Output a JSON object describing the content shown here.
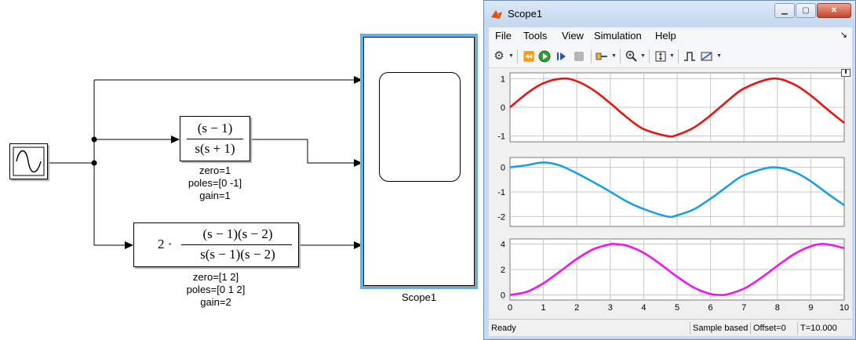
{
  "diagram": {
    "tf1": {
      "numerator": "(s − 1)",
      "denominator": "s(s + 1)",
      "zero": "zero=1",
      "poles": "poles=[0 -1]",
      "gain": "gain=1"
    },
    "tf2": {
      "prefix": "2 ·",
      "numerator": "(s − 1)(s − 2)",
      "denominator": "s(s − 1)(s − 2)",
      "zero": "zero=[1 2]",
      "poles": "poles=[0 1 2]",
      "gain": "gain=2"
    },
    "scope_label": "Scope1"
  },
  "window": {
    "title": "Scope1",
    "menu": [
      "File",
      "Tools",
      "View",
      "Simulation",
      "Help"
    ],
    "toolbar_icons": [
      "gear-icon",
      "step-back-icon",
      "run-icon",
      "step-forward-icon",
      "stop-icon",
      "highlight-icon",
      "zoom-icon",
      "autoscale-icon",
      "triggers-icon",
      "measurements-icon"
    ],
    "status": {
      "state": "Ready",
      "mode": "Sample based",
      "offset": "Offset=0",
      "time": "T=10.000"
    }
  },
  "chart_data": [
    {
      "type": "line",
      "x": [
        0,
        0.5,
        1,
        1.5708,
        2,
        2.5,
        3,
        3.5,
        4,
        4.7124,
        5,
        5.5,
        6,
        6.5,
        7,
        7.854,
        8.5,
        9,
        9.5,
        10
      ],
      "series": [
        {
          "values": [
            0,
            0.479,
            0.841,
            1,
            0.909,
            0.598,
            0.141,
            -0.351,
            -0.757,
            -1,
            -0.959,
            -0.706,
            -0.279,
            0.215,
            0.657,
            1,
            0.798,
            0.412,
            -0.075,
            -0.544
          ]
        }
      ],
      "ylim": [
        -1.2,
        1.2
      ],
      "yticks": [
        "1",
        "0",
        "-1"
      ],
      "color": "#e8140f",
      "grid": true
    },
    {
      "type": "line",
      "x": [
        0,
        0.5,
        1,
        1.5,
        2,
        2.5,
        3,
        3.5,
        4,
        4.7124,
        5,
        5.5,
        6,
        6.5,
        7,
        7.854,
        8.5,
        9,
        9.5,
        10
      ],
      "series": [
        {
          "values": [
            0,
            0.086,
            0.197,
            0.071,
            -0.244,
            -0.605,
            -0.991,
            -1.392,
            -1.695,
            -2,
            -1.95,
            -1.707,
            -1.276,
            -0.777,
            -0.323,
            0,
            -0.188,
            -0.566,
            -1.068,
            -1.54
          ]
        }
      ],
      "ylim": [
        -2.4,
        0.4
      ],
      "yticks": [
        "0",
        "-1",
        "-2"
      ],
      "color": "#1f9ee8",
      "grid": true
    },
    {
      "type": "line",
      "x": [
        0,
        0.5,
        1,
        1.5,
        2,
        2.5,
        3,
        3.1416,
        3.5,
        4,
        4.5,
        5,
        5.5,
        6,
        6.2832,
        6.5,
        7,
        7.5,
        8,
        8.5,
        9,
        9.4248,
        10
      ],
      "series": [
        {
          "values": [
            0,
            0.245,
            0.919,
            1.859,
            2.832,
            3.602,
            3.98,
            4,
            3.873,
            3.307,
            2.42,
            1.433,
            0.583,
            0.08,
            0,
            0.047,
            0.495,
            1.316,
            2.291,
            3.204,
            3.822,
            4,
            3.678
          ]
        }
      ],
      "ylim": [
        -0.4,
        4.4
      ],
      "yticks": [
        "4",
        "2",
        "0"
      ],
      "xlim": [
        0,
        10
      ],
      "xticks": [
        "0",
        "1",
        "2",
        "3",
        "4",
        "5",
        "6",
        "7",
        "8",
        "9",
        "10"
      ],
      "color": "#f014f0",
      "grid": true
    }
  ]
}
